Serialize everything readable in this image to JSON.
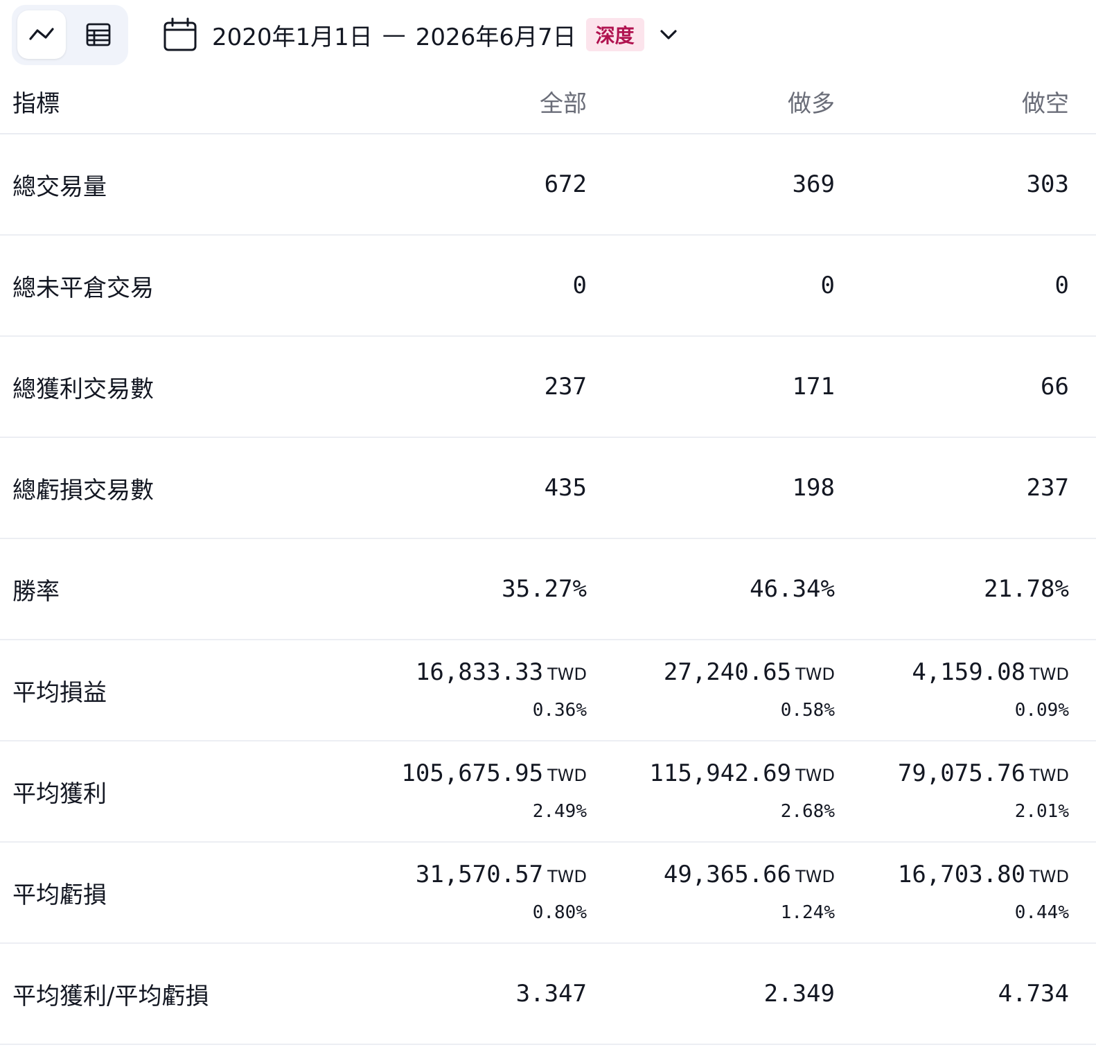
{
  "toolbar": {
    "view_toggle": {
      "chart_icon": "trend-line-icon",
      "table_icon": "table-icon",
      "active": "chart"
    },
    "date_range": {
      "icon": "calendar-icon",
      "start": "2020年1月1日",
      "separator": "—",
      "end": "2026年6月7日",
      "badge": "深度",
      "dropdown_icon": "chevron-down-icon"
    }
  },
  "colors": {
    "badge_bg": "#fce4ec",
    "badge_text": "#b0124f",
    "header_text": "#6a6d78",
    "divider": "#eceef3",
    "toggle_bg": "#f0f3fa"
  },
  "table": {
    "headers": {
      "metric": "指標",
      "all": "全部",
      "long": "做多",
      "short": "做空"
    },
    "rows": [
      {
        "name": "總交易量",
        "all": {
          "value": "672"
        },
        "long": {
          "value": "369"
        },
        "short": {
          "value": "303"
        }
      },
      {
        "name": "總未平倉交易",
        "all": {
          "value": "0"
        },
        "long": {
          "value": "0"
        },
        "short": {
          "value": "0"
        }
      },
      {
        "name": "總獲利交易數",
        "all": {
          "value": "237"
        },
        "long": {
          "value": "171"
        },
        "short": {
          "value": "66"
        }
      },
      {
        "name": "總虧損交易數",
        "all": {
          "value": "435"
        },
        "long": {
          "value": "198"
        },
        "short": {
          "value": "237"
        }
      },
      {
        "name": "勝率",
        "all": {
          "value": "35.27%"
        },
        "long": {
          "value": "46.34%"
        },
        "short": {
          "value": "21.78%"
        }
      },
      {
        "name": "平均損益",
        "all": {
          "value": "16,833.33",
          "unit": "TWD",
          "pct": "0.36%"
        },
        "long": {
          "value": "27,240.65",
          "unit": "TWD",
          "pct": "0.58%"
        },
        "short": {
          "value": "4,159.08",
          "unit": "TWD",
          "pct": "0.09%"
        }
      },
      {
        "name": "平均獲利",
        "all": {
          "value": "105,675.95",
          "unit": "TWD",
          "pct": "2.49%"
        },
        "long": {
          "value": "115,942.69",
          "unit": "TWD",
          "pct": "2.68%"
        },
        "short": {
          "value": "79,075.76",
          "unit": "TWD",
          "pct": "2.01%"
        }
      },
      {
        "name": "平均虧損",
        "all": {
          "value": "31,570.57",
          "unit": "TWD",
          "pct": "0.80%"
        },
        "long": {
          "value": "49,365.66",
          "unit": "TWD",
          "pct": "1.24%"
        },
        "short": {
          "value": "16,703.80",
          "unit": "TWD",
          "pct": "0.44%"
        }
      },
      {
        "name": "平均獲利/平均虧損",
        "all": {
          "value": "3.347"
        },
        "long": {
          "value": "2.349"
        },
        "short": {
          "value": "4.734"
        }
      }
    ]
  }
}
